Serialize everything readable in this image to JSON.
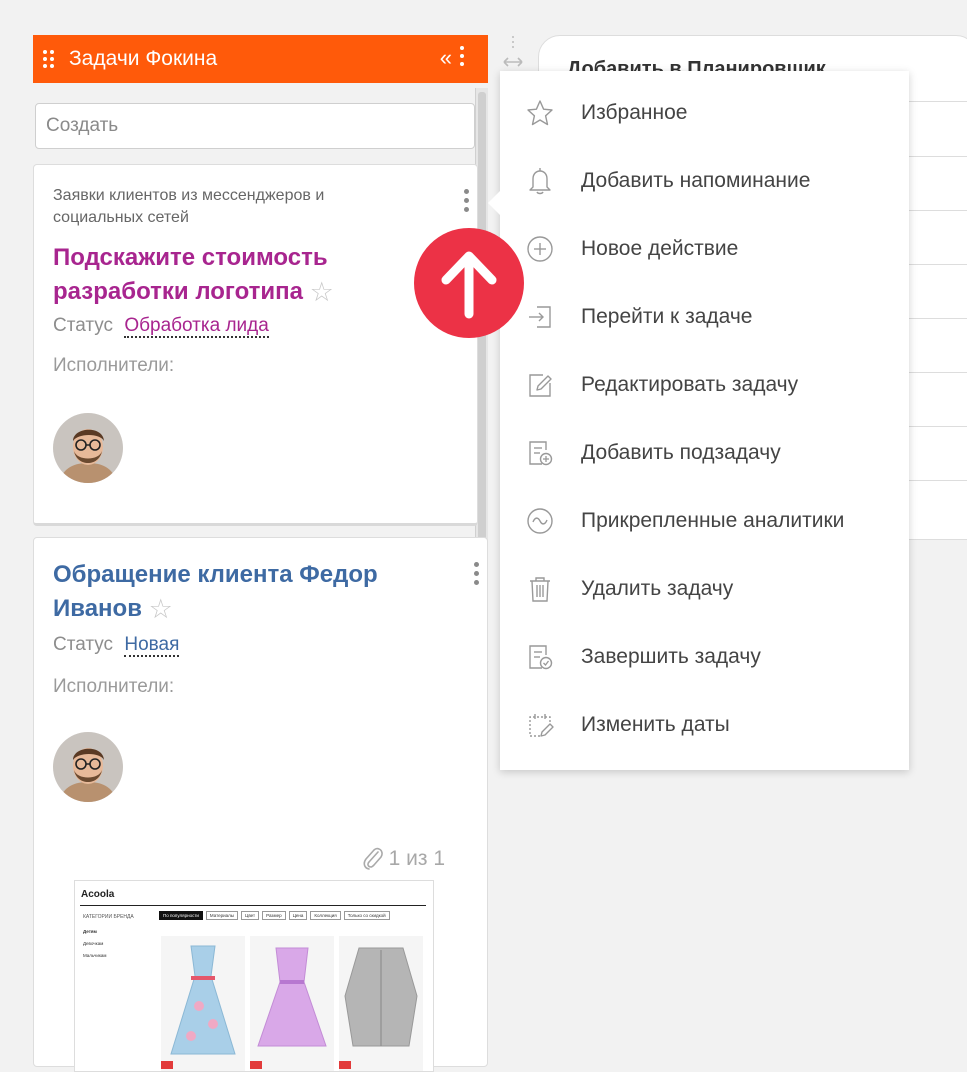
{
  "column": {
    "title": "Задачи Фокина",
    "collapse_glyph": "«",
    "create_placeholder": "Создать",
    "header_color": "#ff5a0a"
  },
  "cards": [
    {
      "category": "Заявки клиентов из мессенджеров и социальных сетей",
      "title": "Подскажите стоимость разработки логотипа",
      "status_label": "Статус",
      "status_value": "Обработка лида",
      "assignees_label": "Исполнители:",
      "title_color": "#a8258f"
    },
    {
      "title": "Обращение клиента Федор Иванов",
      "status_label": "Статус",
      "status_value": "Новая",
      "assignees_label": "Исполнители:",
      "attachment_counter": "1 из 1",
      "title_color": "#3e6aa3",
      "thumbnail": {
        "brand": "Acoola",
        "categories_title": "КАТЕГОРИИ БРЕНДА",
        "categories": [
          "Детям",
          "Девочкам",
          "Мальчикам"
        ],
        "sort_options": [
          "По популярности",
          "Материалы",
          "Цвет",
          "Размер",
          "Цена",
          "Коллекция",
          "Только со скидкой"
        ]
      }
    }
  ],
  "panel": {
    "title": "Добавить в Планировщик"
  },
  "context_menu": {
    "items": [
      {
        "label": "Избранное",
        "icon": "star-icon"
      },
      {
        "label": "Добавить напоминание",
        "icon": "bell-icon"
      },
      {
        "label": "Новое действие",
        "icon": "plus-circle-icon"
      },
      {
        "label": "Перейти к задаче",
        "icon": "enter-icon"
      },
      {
        "label": "Редактировать задачу",
        "icon": "edit-icon"
      },
      {
        "label": "Добавить подзадачу",
        "icon": "add-subtask-icon"
      },
      {
        "label": "Прикрепленные аналитики",
        "icon": "wave-circle-icon"
      },
      {
        "label": "Удалить задачу",
        "icon": "trash-icon"
      },
      {
        "label": "Завершить задачу",
        "icon": "complete-icon"
      },
      {
        "label": "Изменить даты",
        "icon": "calendar-edit-icon"
      }
    ]
  },
  "pointer_annotation": {
    "icon": "up-arrow-icon",
    "color": "#ec3246"
  }
}
